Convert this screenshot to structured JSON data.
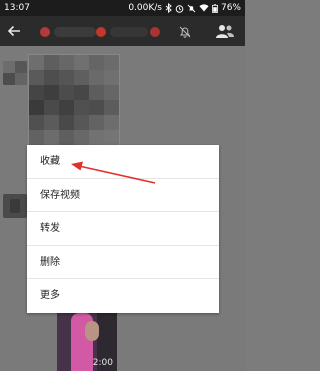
{
  "status_bar": {
    "time": "13:07",
    "network_speed": "0.00K/s",
    "battery": "76%",
    "icons": [
      "bluetooth-icon",
      "alarm-icon",
      "mute-icon",
      "wifi-icon",
      "battery-icon"
    ]
  },
  "title_bar": {
    "contact_name": "",
    "icons": [
      "back-arrow-icon",
      "mute-icon",
      "profile-icon"
    ]
  },
  "video": {
    "duration": "2:00"
  },
  "context_menu": {
    "items": [
      "收藏",
      "保存视频",
      "转发",
      "删除",
      "更多"
    ]
  },
  "colors": {
    "status_bar_bg": "#1c1c1c",
    "title_bar_bg": "#2b2b2b",
    "overlay": "#7c7c7c",
    "menu_bg": "#ffffff",
    "annotation_arrow": "#e0312b"
  }
}
